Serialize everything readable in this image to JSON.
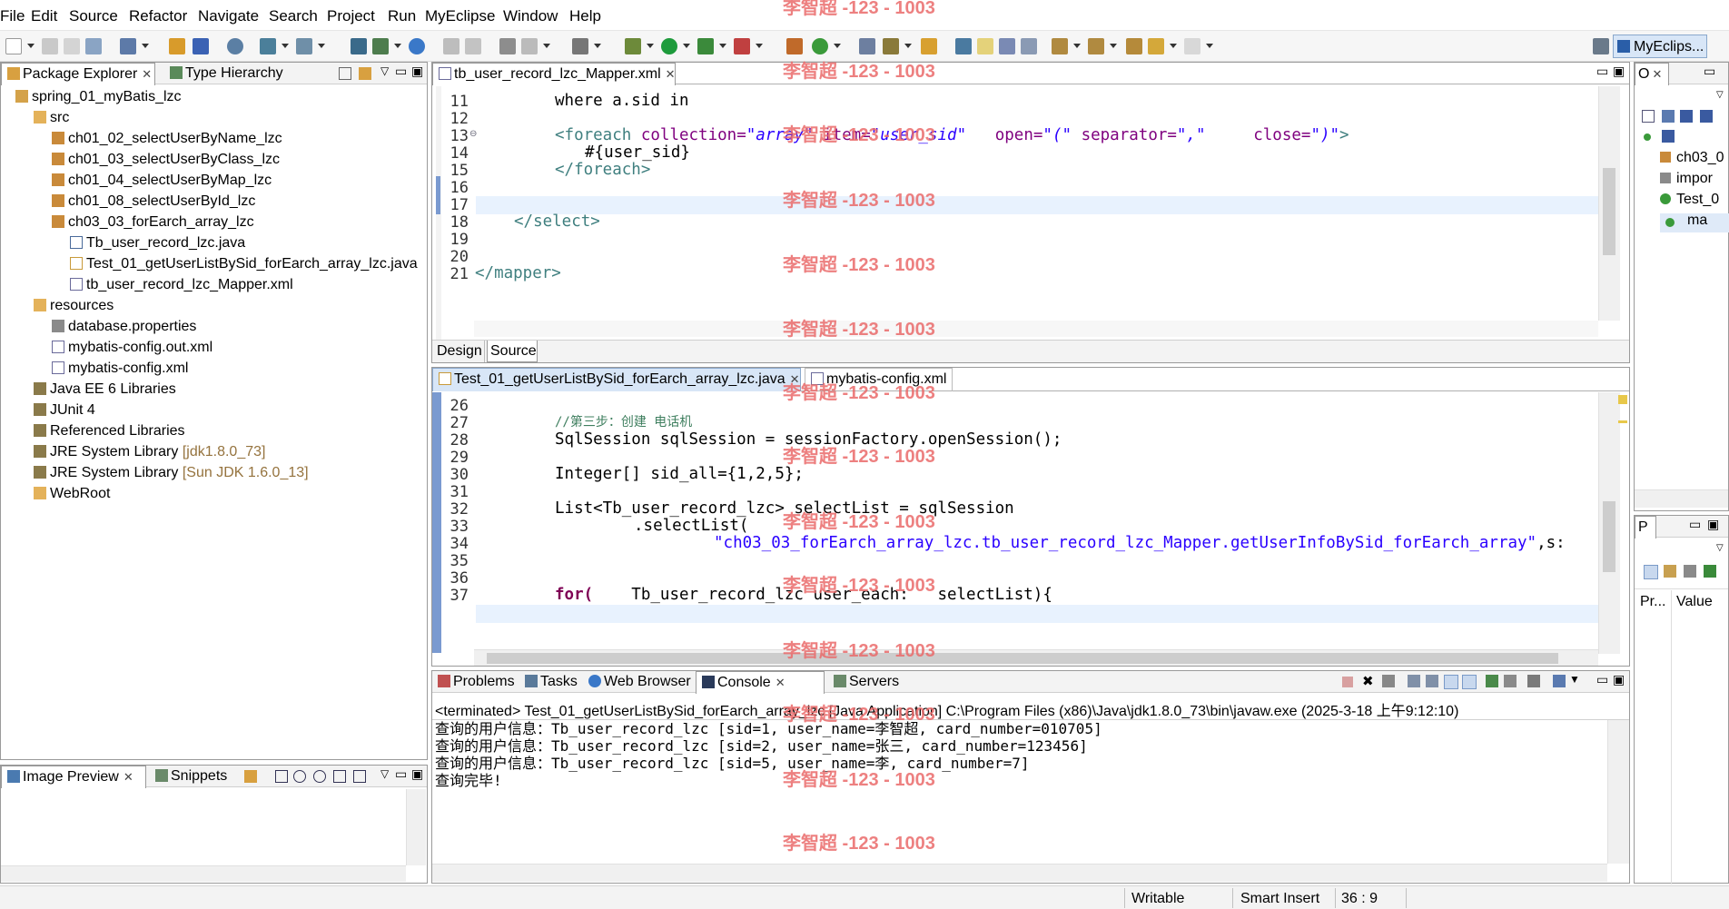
{
  "menu": [
    "File",
    "Edit",
    "Source",
    "Refactor",
    "Navigate",
    "Search",
    "Project",
    "Run",
    "MyEclipse",
    "Window",
    "Help"
  ],
  "perspective": "MyEclips...",
  "watermark": "李智超 -123 - 1003",
  "left_panel": {
    "tabs": [
      "Package Explorer",
      "Type Hierarchy"
    ],
    "tree": [
      {
        "label": "spring_01_myBatis_lzc",
        "suffix": ""
      },
      {
        "label": "src",
        "suffix": ""
      },
      {
        "label": "ch01_02_selectUserByName_lzc",
        "suffix": ""
      },
      {
        "label": "ch01_03_selectUserByClass_lzc",
        "suffix": ""
      },
      {
        "label": "ch01_04_selectUserByMap_lzc",
        "suffix": ""
      },
      {
        "label": "ch01_08_selectUserById_lzc",
        "suffix": ""
      },
      {
        "label": "ch03_03_forEarch_array_lzc",
        "suffix": ""
      },
      {
        "label": "Tb_user_record_lzc.java",
        "suffix": ""
      },
      {
        "label": "Test_01_getUserListBySid_forEarch_array_lzc.java",
        "suffix": ""
      },
      {
        "label": "tb_user_record_lzc_Mapper.xml",
        "suffix": ""
      },
      {
        "label": "resources",
        "suffix": ""
      },
      {
        "label": "database.properties",
        "suffix": ""
      },
      {
        "label": "mybatis-config.out.xml",
        "suffix": ""
      },
      {
        "label": "mybatis-config.xml",
        "suffix": ""
      },
      {
        "label": "Java EE 6 Libraries",
        "suffix": ""
      },
      {
        "label": "JUnit 4",
        "suffix": ""
      },
      {
        "label": "Referenced Libraries",
        "suffix": ""
      },
      {
        "label": "JRE System Library",
        "suffix": "[jdk1.8.0_73]"
      },
      {
        "label": "JRE System Library",
        "suffix": "[Sun JDK 1.6.0_13]"
      },
      {
        "label": "WebRoot",
        "suffix": ""
      }
    ],
    "bottom_tabs": [
      "Image Preview",
      "Snippets"
    ]
  },
  "xml_editor": {
    "tab": "tb_user_record_lzc_Mapper.xml",
    "lines": [
      "11",
      "12",
      "13",
      "14",
      "15",
      "16",
      "17",
      "18",
      "19",
      "20",
      "21"
    ],
    "code": {
      "l11": "where a.sid in",
      "l13_tag": "<foreach",
      "l13_a1": "collection=",
      "l13_v1": "\"array\"",
      "l13_a2": "item=",
      "l13_v2": "\"user_sid\"",
      "l13_a3": "open=",
      "l13_v3": "\"(\"",
      "l13_a4": "separator=",
      "l13_v4": "\",\"",
      "l13_a5": "close=",
      "l13_v5": "\")\"",
      "l13_end": ">",
      "l14": "#{user_sid}",
      "l15": "</foreach>",
      "l18": "</select>",
      "l21": "</mapper>"
    },
    "bottom_tabs": [
      "Design",
      "Source"
    ]
  },
  "java_editor": {
    "tabs": [
      "Test_01_getUserListBySid_forEarch_array_lzc.java",
      "mybatis-config.xml"
    ],
    "lines": [
      "26",
      "27",
      "28",
      "29",
      "30",
      "31",
      "32",
      "33",
      "34",
      "35",
      "36",
      "37"
    ],
    "code": {
      "l27": "//第三步：创建 电话机",
      "l28": "SqlSession sqlSession = sessionFactory.openSession();",
      "l30": "Integer[] sid_all={1,2,5};",
      "l32": "List<Tb_user_record_lzc> selectList = sqlSession",
      "l33": ".selectList(",
      "l34_str": "\"ch03_03_forEarch_array_lzc.tb_user_record_lzc_Mapper.getUserInfoBySid_forEarch_array\"",
      "l34_tail": ",s:",
      "l37_kw": "for(",
      "l37_rest": "    Tb_user_record_lzc user_each:   selectList){"
    }
  },
  "console": {
    "tabs": [
      "Problems",
      "Tasks",
      "Web Browser",
      "Console",
      "Servers"
    ],
    "header": "<terminated> Test_01_getUserListBySid_forEarch_array_lzc [Java Application] C:\\Program Files (x86)\\Java\\jdk1.8.0_73\\bin\\javaw.exe (2025-3-18 上午9:12:10)",
    "output": [
      "查询的用户信息：Tb_user_record_lzc [sid=1, user_name=李智超, card_number=010705]",
      "查询的用户信息：Tb_user_record_lzc [sid=2, user_name=张三, card_number=123456]",
      "查询的用户信息：Tb_user_record_lzc [sid=5, user_name=李, card_number=7]",
      "查询完毕!"
    ]
  },
  "outline": {
    "tab": "O",
    "items": [
      "ch03_0",
      "impor",
      "Test_0",
      "ma"
    ]
  },
  "properties": {
    "tab": "P",
    "columns": [
      "Pr...",
      "Value"
    ]
  },
  "status": {
    "writable": "Writable",
    "insert": "Smart Insert",
    "position": "36 : 9"
  },
  "colors": {
    "accent": "#dfeaf8",
    "watermark": "#ea6b6b"
  }
}
